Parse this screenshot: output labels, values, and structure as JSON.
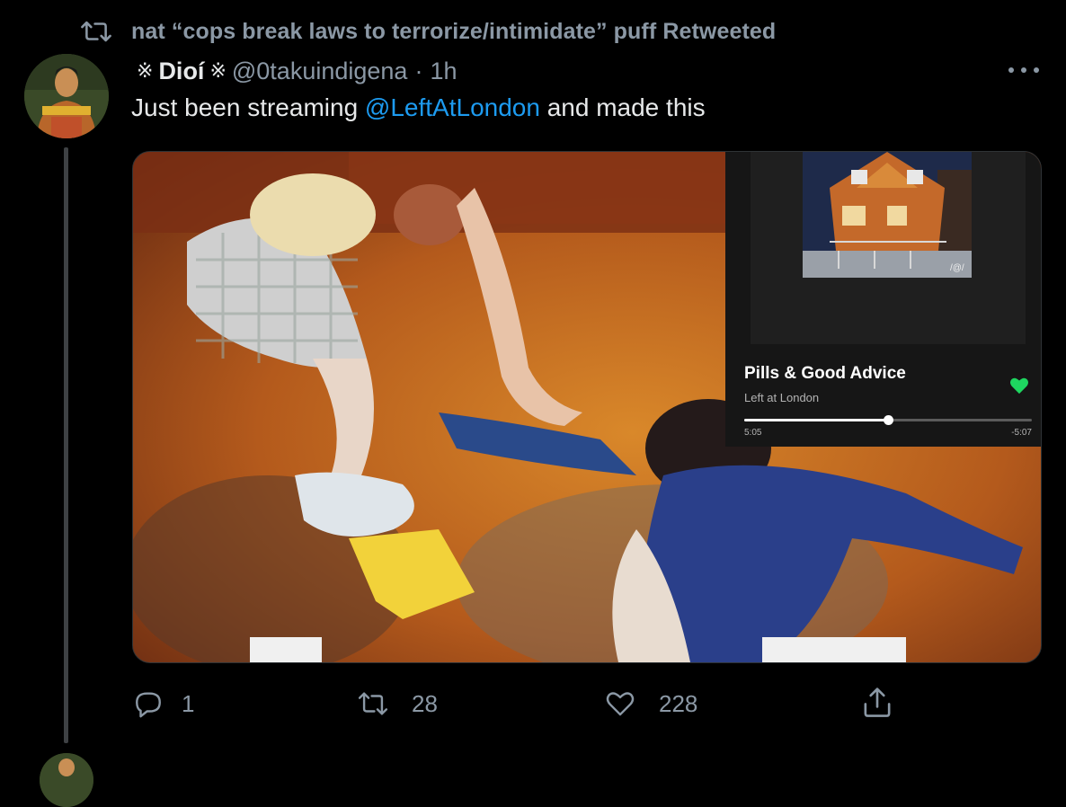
{
  "retweet": {
    "text": "nat “cops break laws to terrorize/intimidate” puff Retweeted"
  },
  "tweet": {
    "author_name": "Dioí",
    "name_decoration": "※",
    "handle": "@0takuindigena",
    "separator": "·",
    "time": "1h",
    "text_before": "Just been streaming ",
    "mention": "@LeftAtLondon",
    "text_after": " and made this"
  },
  "player": {
    "track_title": "Pills & Good Advice",
    "artist": "Left at London",
    "elapsed": "5:05",
    "remaining": "-5:07",
    "progress_fraction": 0.5,
    "liked": true,
    "accent_color": "#1ed760"
  },
  "actions": {
    "replies": "1",
    "retweets": "28",
    "likes": "228"
  },
  "colors": {
    "background": "#000000",
    "text_primary": "#e7e9ea",
    "text_secondary": "#8b98a5",
    "link": "#1d9bf0"
  },
  "icons": [
    "retweet-icon",
    "more-icon",
    "reply-icon",
    "like-icon",
    "share-icon"
  ]
}
